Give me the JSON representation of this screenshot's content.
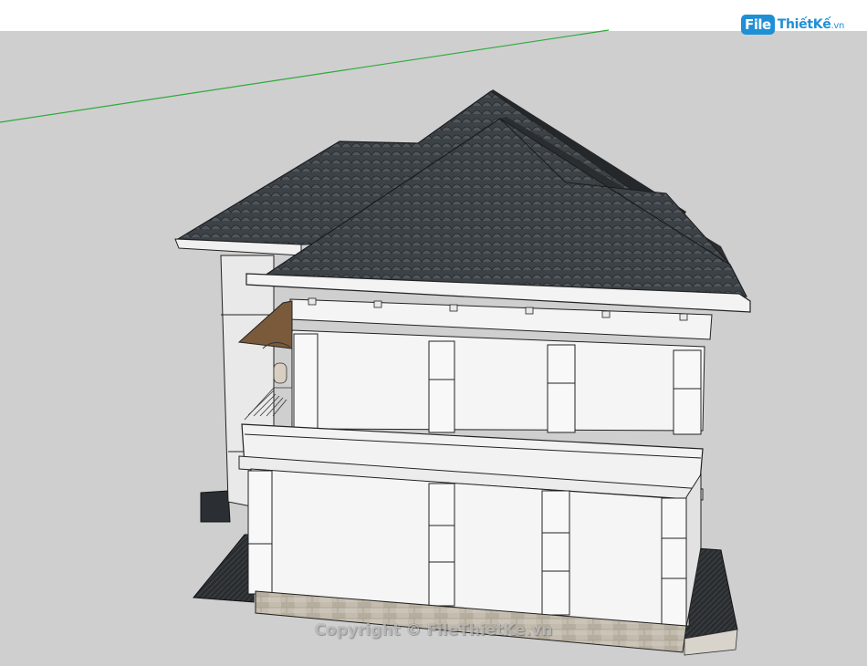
{
  "branding": {
    "logo_file": "File",
    "logo_rest": "ThiếtKế",
    "logo_tld": ".vn",
    "brand_color": "#1f8fd6"
  },
  "watermark": {
    "text": "Copyright © FileThietKe.vn"
  },
  "scene": {
    "sky_color": "#ffffff",
    "ground_color": "#cfcfcf",
    "horizon_axis_color": "#2eaa3a",
    "roof_color": "#3e4347",
    "wall_color": "#f4f4f4",
    "plinth_color": "#bfb8aa",
    "edge_color": "#202020"
  }
}
